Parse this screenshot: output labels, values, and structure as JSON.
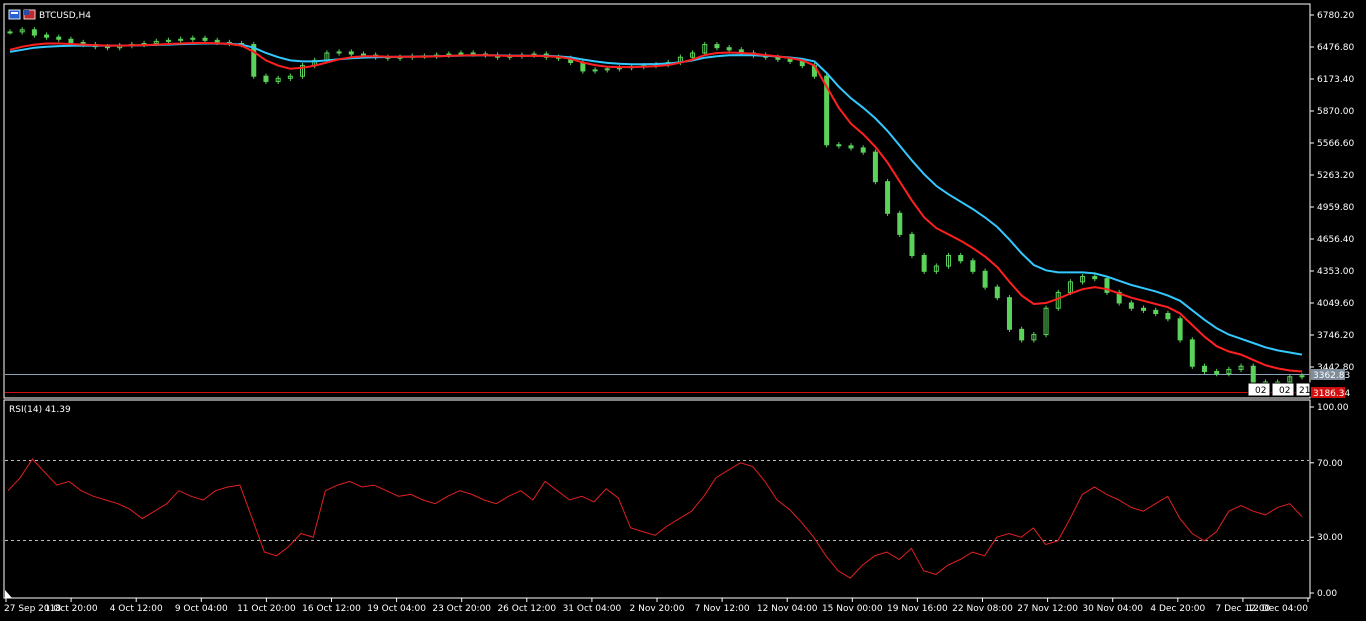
{
  "window": {
    "symbol_title": "BTCUSD,H4",
    "indicator_label": "RSI(14) 41.39"
  },
  "price_levels": {
    "bid": "3362.83",
    "low_line": "3186.34",
    "scale_badge": "02",
    "scale_badge_2": "02",
    "scale_badge_3": "21"
  },
  "colors": {
    "background": "#000000",
    "frame": "#ffffff",
    "candle": "#5bd35b",
    "ma_fast": "#ff2020",
    "ma_slow": "#33c8ff",
    "rsi": "#e02020",
    "bid_line": "#8aa0b8",
    "low_line": "#d01010"
  },
  "icons": [
    "chart-window-icon",
    "symbol-flag-icon"
  ],
  "chart_data": [
    {
      "type": "line",
      "title": "BTCUSD,H4",
      "y_ticks": [
        "6780.20",
        "6476.80",
        "6173.40",
        "5870.00",
        "5566.60",
        "5263.20",
        "4959.80",
        "4656.40",
        "4353.00",
        "4049.60",
        "3746.20",
        "3442.80"
      ],
      "ylim": [
        3150,
        6800
      ],
      "x_ticks": [
        "27 Sep 2018",
        "1 Oct 20:00",
        "4 Oct 12:00",
        "9 Oct 04:00",
        "11 Oct 20:00",
        "16 Oct 12:00",
        "19 Oct 04:00",
        "23 Oct 20:00",
        "26 Oct 12:00",
        "31 Oct 04:00",
        "2 Nov 20:00",
        "7 Nov 12:00",
        "12 Nov 04:00",
        "15 Nov 00:00",
        "19 Nov 16:00",
        "22 Nov 08:00",
        "27 Nov 12:00",
        "30 Nov 04:00",
        "4 Dec 20:00",
        "7 Dec 12:00",
        "12 Dec 04:00"
      ],
      "series": [
        {
          "kind": "price",
          "values": [
            6620,
            6640,
            6590,
            6570,
            6550,
            6520,
            6500,
            6480,
            6470,
            6490,
            6500,
            6510,
            6530,
            6540,
            6550,
            6560,
            6540,
            6520,
            6510,
            6500,
            6200,
            6150,
            6180,
            6200,
            6300,
            6350,
            6420,
            6430,
            6410,
            6400,
            6380,
            6370,
            6380,
            6390,
            6390,
            6400,
            6410,
            6420,
            6410,
            6400,
            6380,
            6390,
            6400,
            6410,
            6380,
            6370,
            6330,
            6250,
            6260,
            6270,
            6280,
            6290,
            6300,
            6310,
            6330,
            6380,
            6420,
            6500,
            6470,
            6450,
            6420,
            6400,
            6380,
            6360,
            6340,
            6300,
            6200,
            5550,
            5540,
            5520,
            5480,
            5200,
            4900,
            4700,
            4500,
            4350,
            4400,
            4500,
            4450,
            4350,
            4200,
            4100,
            3800,
            3700,
            3750,
            4000,
            4150,
            4250,
            4300,
            4280,
            4150,
            4050,
            4000,
            3980,
            3950,
            3900,
            3700,
            3450,
            3400,
            3380,
            3420,
            3450,
            3300,
            3250,
            3300,
            3350,
            3360
          ]
        },
        {
          "kind": "ma_fast",
          "values": [
            6450,
            6480,
            6500,
            6510,
            6510,
            6505,
            6500,
            6495,
            6490,
            6490,
            6492,
            6495,
            6500,
            6505,
            6510,
            6515,
            6515,
            6512,
            6505,
            6490,
            6430,
            6350,
            6300,
            6270,
            6280,
            6300,
            6330,
            6360,
            6380,
            6390,
            6390,
            6385,
            6385,
            6385,
            6386,
            6388,
            6392,
            6396,
            6398,
            6398,
            6395,
            6392,
            6392,
            6394,
            6390,
            6383,
            6365,
            6330,
            6305,
            6290,
            6286,
            6286,
            6290,
            6296,
            6306,
            6328,
            6358,
            6400,
            6420,
            6425,
            6420,
            6412,
            6400,
            6388,
            6372,
            6350,
            6300,
            6100,
            5900,
            5750,
            5650,
            5530,
            5380,
            5200,
            5020,
            4860,
            4760,
            4700,
            4640,
            4570,
            4490,
            4390,
            4250,
            4120,
            4040,
            4050,
            4090,
            4140,
            4180,
            4200,
            4180,
            4140,
            4100,
            4070,
            4040,
            4010,
            3950,
            3840,
            3730,
            3640,
            3590,
            3560,
            3510,
            3460,
            3430,
            3410,
            3400
          ]
        },
        {
          "kind": "ma_slow",
          "values": [
            6430,
            6450,
            6470,
            6480,
            6485,
            6488,
            6490,
            6490,
            6490,
            6490,
            6492,
            6494,
            6497,
            6500,
            6504,
            6508,
            6510,
            6510,
            6508,
            6500,
            6470,
            6420,
            6380,
            6350,
            6340,
            6340,
            6350,
            6360,
            6370,
            6376,
            6380,
            6382,
            6384,
            6386,
            6388,
            6390,
            6392,
            6395,
            6397,
            6398,
            6397,
            6395,
            6394,
            6394,
            6392,
            6388,
            6378,
            6358,
            6340,
            6326,
            6318,
            6314,
            6314,
            6316,
            6320,
            6332,
            6350,
            6375,
            6390,
            6398,
            6400,
            6398,
            6393,
            6386,
            6377,
            6364,
            6340,
            6230,
            6100,
            5990,
            5900,
            5800,
            5680,
            5540,
            5400,
            5270,
            5160,
            5080,
            5010,
            4940,
            4860,
            4770,
            4650,
            4520,
            4410,
            4360,
            4340,
            4340,
            4340,
            4330,
            4300,
            4260,
            4220,
            4190,
            4160,
            4120,
            4070,
            3980,
            3890,
            3810,
            3750,
            3710,
            3670,
            3630,
            3600,
            3580,
            3560
          ]
        }
      ]
    },
    {
      "type": "line",
      "title": "RSI(14) 41.39",
      "y_ticks": [
        "100.00",
        "70.00",
        "30.00",
        "0.00"
      ],
      "ylim": [
        0,
        100
      ],
      "series": [
        {
          "kind": "rsi",
          "values": [
            55,
            62,
            72,
            65,
            58,
            60,
            55,
            52,
            50,
            48,
            45,
            40,
            44,
            48,
            55,
            52,
            50,
            55,
            57,
            58,
            40,
            22,
            20,
            25,
            32,
            30,
            55,
            58,
            60,
            57,
            58,
            55,
            52,
            53,
            50,
            48,
            52,
            55,
            53,
            50,
            48,
            52,
            55,
            50,
            60,
            55,
            50,
            52,
            49,
            56,
            51,
            35,
            33,
            31,
            36,
            40,
            44,
            52,
            62,
            66,
            70,
            68,
            60,
            50,
            45,
            38,
            30,
            20,
            12,
            8,
            15,
            20,
            22,
            18,
            24,
            12,
            10,
            15,
            18,
            22,
            20,
            30,
            32,
            30,
            35,
            26,
            28,
            40,
            53,
            57,
            53,
            50,
            46,
            44,
            48,
            52,
            40,
            32,
            28,
            33,
            44,
            47,
            44,
            42,
            46,
            48,
            41
          ]
        }
      ]
    }
  ]
}
